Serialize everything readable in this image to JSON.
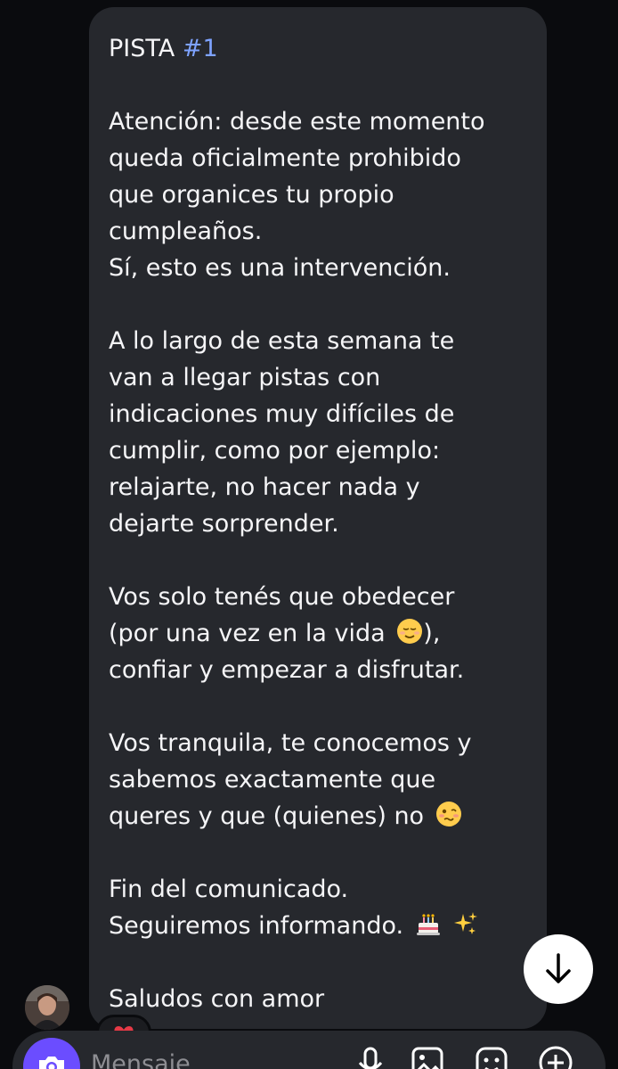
{
  "message": {
    "title_prefix": "PISTA ",
    "title_hashtag": "#1",
    "lines": [
      "Atención: desde este momento",
      "queda oficialmente prohibido",
      "que organices tu propio",
      "cumpleaños.",
      "Sí, esto es una intervención.",
      "A lo largo de esta semana te",
      "van a llegar pistas con",
      "indicaciones muy difíciles de",
      "cumplir, como por ejemplo:",
      "relajarte, no hacer nada y",
      "dejarte sorprender.",
      "Vos solo tenés que obedecer",
      "(por una vez en la vida",
      ")",
      "confiar y empezar a disfrutar.",
      "Vos tranquila, te conocemos y",
      "sabemos exactamente que",
      "queres y que (quienes) no",
      "Fin del comunicado.",
      "Seguiremos informando.",
      "Saludos con amor"
    ],
    "line_17_suffix": ",",
    "emojis": {
      "relieved": "relieved-face-emoji",
      "woozy": "woozy-face-emoji",
      "cake": "birthday-cake-emoji",
      "sparkles": "sparkles-emoji"
    }
  },
  "reaction": {
    "icon": "heart-icon"
  },
  "composer": {
    "placeholder": "Mensaje",
    "icons": [
      "camera-icon",
      "microphone-icon",
      "gallery-icon",
      "sticker-icon",
      "add-icon"
    ]
  },
  "colors": {
    "bubble": "#26282d",
    "background": "#0a0b0e",
    "hashtag": "#7ea3ff",
    "camera_button": "#6b4dff"
  }
}
